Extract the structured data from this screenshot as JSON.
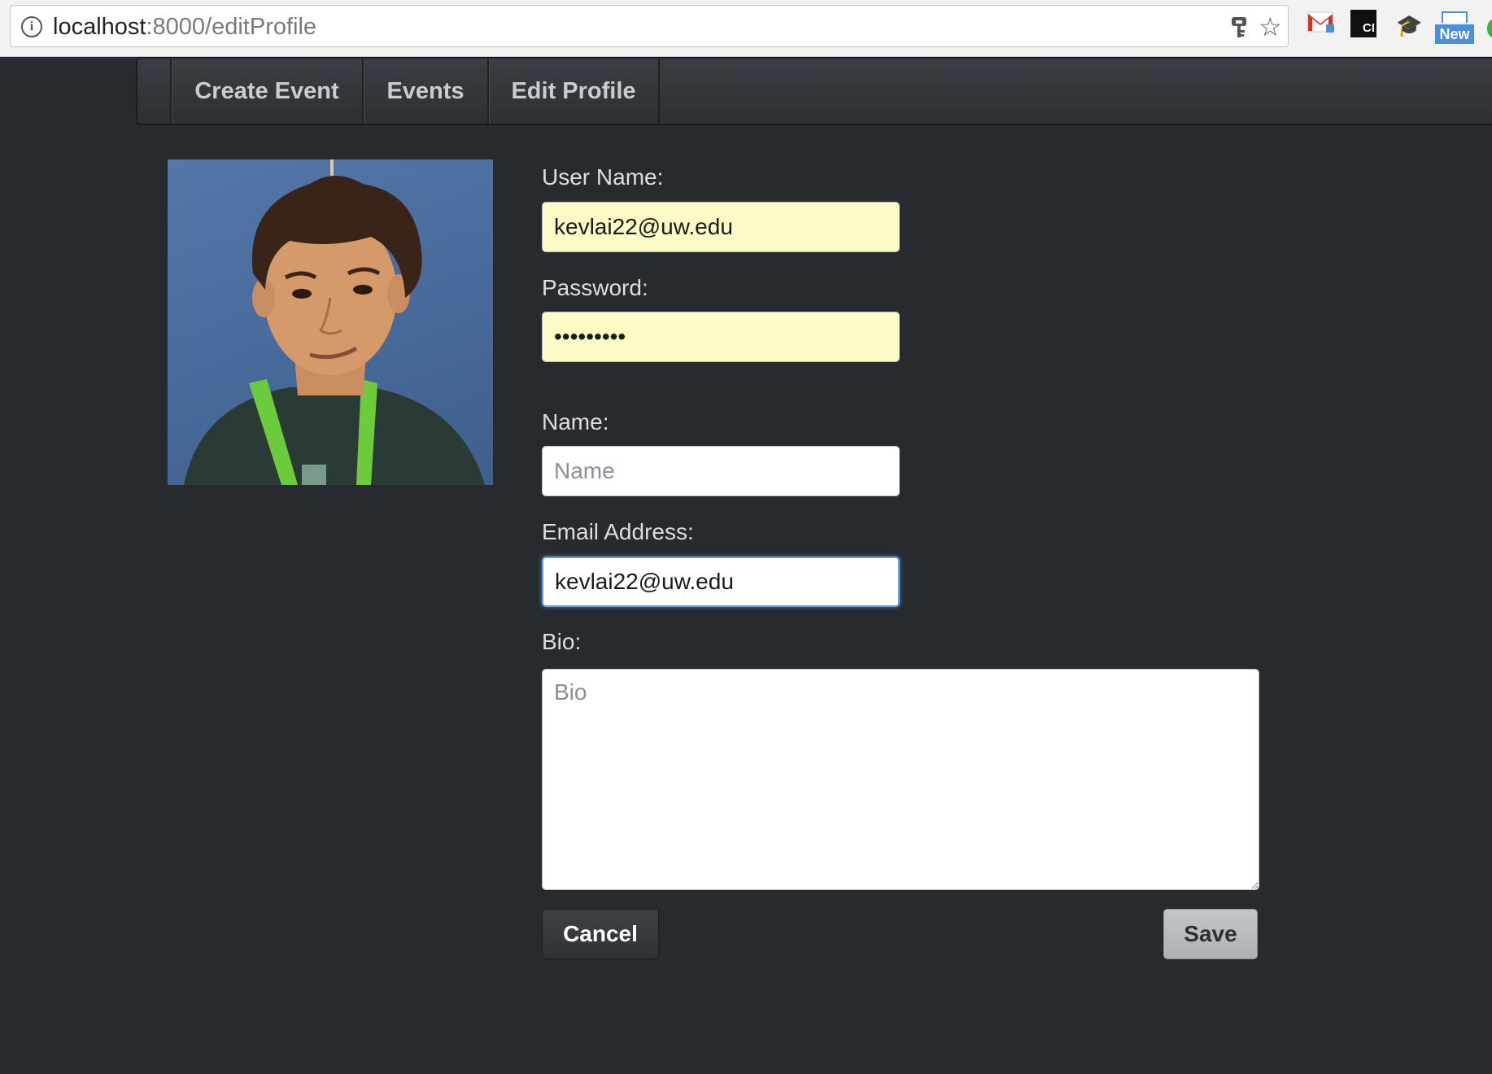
{
  "browser": {
    "url_host": "localhost",
    "url_rest": ":8000/editProfile",
    "extension_ci_label": "CI",
    "extension_new_label": "New"
  },
  "nav": {
    "items": [
      {
        "label": "Create Event"
      },
      {
        "label": "Events"
      },
      {
        "label": "Edit Profile"
      }
    ]
  },
  "form": {
    "username": {
      "label": "User Name:",
      "value": "kevlai22@uw.edu"
    },
    "password": {
      "label": "Password:",
      "value": "•••••••••"
    },
    "name": {
      "label": "Name:",
      "placeholder": "Name",
      "value": ""
    },
    "email": {
      "label": "Email Address:",
      "value": "kevlai22@uw.edu"
    },
    "bio": {
      "label": "Bio:",
      "placeholder": "Bio",
      "value": ""
    },
    "cancel_label": "Cancel",
    "save_label": "Save"
  },
  "colors": {
    "page_background": "#272a2f",
    "autofill_background": "#fbfbc6",
    "focus_ring": "#5aa1e6"
  }
}
